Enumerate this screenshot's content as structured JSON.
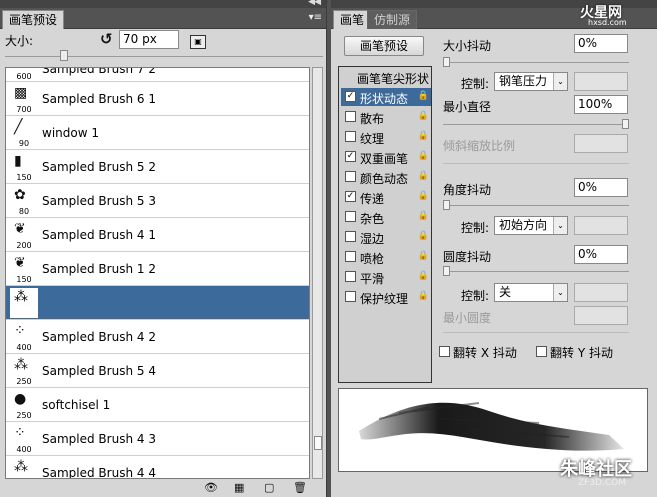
{
  "left": {
    "tab_label": "画笔预设",
    "size_label": "大小:",
    "size_value": "70 px",
    "brushes": [
      {
        "size": "600",
        "name": "Sampled Brush 7 2",
        "partial": true
      },
      {
        "size": "700",
        "name": "Sampled Brush 6 1"
      },
      {
        "size": "90",
        "name": "window 1"
      },
      {
        "size": "150",
        "name": "Sampled Brush 5 2"
      },
      {
        "size": "80",
        "name": "Sampled Brush 5 3"
      },
      {
        "size": "200",
        "name": "Sampled Brush 4 1"
      },
      {
        "size": "150",
        "name": "Sampled Brush 1 2"
      },
      {
        "size": "",
        "name": "",
        "selected": true
      },
      {
        "size": "400",
        "name": "Sampled Brush 4 2"
      },
      {
        "size": "250",
        "name": "Sampled Brush 5 4"
      },
      {
        "size": "250",
        "name": "softchisel 1"
      },
      {
        "size": "400",
        "name": "Sampled Brush 4 3"
      },
      {
        "size": "",
        "name": "Sampled Brush 4 4"
      }
    ]
  },
  "right": {
    "tabs": [
      "画笔",
      "仿制源"
    ],
    "preset_button": "画笔预设",
    "options_header": "画笔笔尖形状",
    "options": [
      {
        "label": "形状动态",
        "checked": true,
        "selected": true
      },
      {
        "label": "散布",
        "checked": false
      },
      {
        "label": "纹理",
        "checked": false
      },
      {
        "label": "双重画笔",
        "checked": true
      },
      {
        "label": "颜色动态",
        "checked": false
      },
      {
        "label": "传递",
        "checked": true
      },
      {
        "label": "杂色",
        "checked": false
      },
      {
        "label": "湿边",
        "checked": false
      },
      {
        "label": "喷枪",
        "checked": false
      },
      {
        "label": "平滑",
        "checked": false
      },
      {
        "label": "保护纹理",
        "checked": false
      }
    ],
    "size_jitter_label": "大小抖动",
    "size_jitter_value": "0%",
    "control_label": "控制:",
    "size_control_value": "钢笔压力",
    "min_diameter_label": "最小直径",
    "min_diameter_value": "100%",
    "tilt_scale_label": "倾斜缩放比例",
    "angle_jitter_label": "角度抖动",
    "angle_jitter_value": "0%",
    "angle_control_value": "初始方向",
    "roundness_jitter_label": "圆度抖动",
    "roundness_jitter_value": "0%",
    "roundness_control_value": "关",
    "min_roundness_label": "最小圆度",
    "flip_x_label": "翻转 X 抖动",
    "flip_y_label": "翻转 Y 抖动"
  },
  "watermark": {
    "top_right": "火星网",
    "top_right_sub": "hxsd.com",
    "bottom_right": "朱峰社区",
    "bottom_right_sub": "ZF3D.COM"
  }
}
